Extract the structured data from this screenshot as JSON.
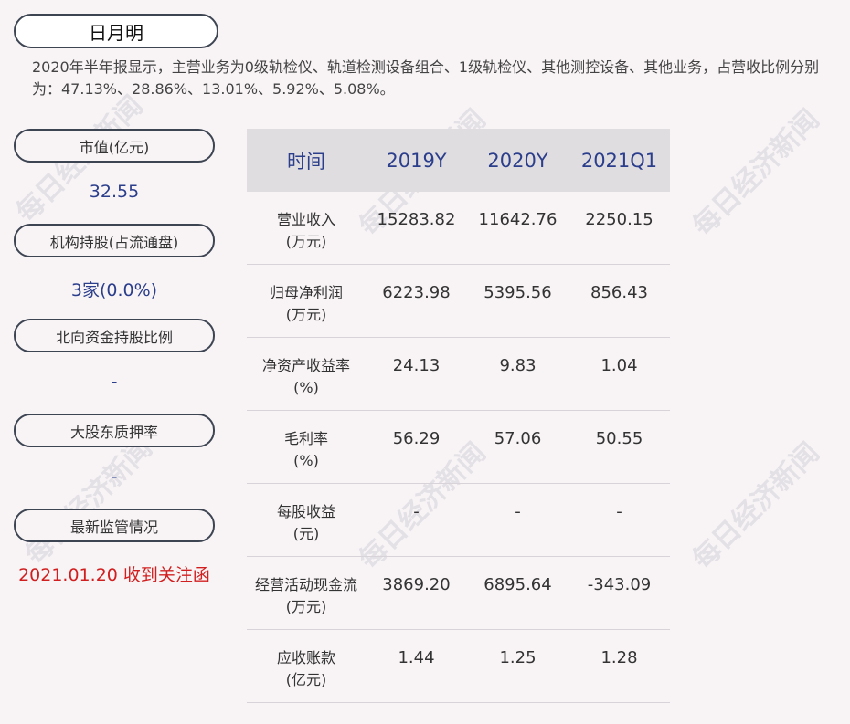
{
  "company": "日月明",
  "summary": "2020年半年报显示，主营业务为0级轨检仪、轨道检测设备组合、1级轨检仪、其他测控设备、其他业务，占营收比例分别为：47.13%、28.86%、13.01%、5.92%、5.08%。",
  "left": {
    "market_cap_label": "市值(亿元)",
    "market_cap_value": "32.55",
    "institution_label": "机构持股(占流通盘)",
    "institution_value": "3家(0.0%)",
    "northbound_label": "北向资金持股比例",
    "northbound_value": "-",
    "pledge_label": "大股东质押率",
    "pledge_value": "-",
    "regulation_label": "最新监管情况",
    "regulation_value": "2021.01.20 收到关注函"
  },
  "table": {
    "header": [
      "时间",
      "2019Y",
      "2020Y",
      "2021Q1"
    ],
    "rows": [
      {
        "label1": "营业收入",
        "label2": "(万元)",
        "values": [
          "15283.82",
          "11642.76",
          "2250.15"
        ]
      },
      {
        "label1": "归母净利润",
        "label2": "(万元)",
        "values": [
          "6223.98",
          "5395.56",
          "856.43"
        ]
      },
      {
        "label1": "净资产收益率",
        "label2": "(%)",
        "values": [
          "24.13",
          "9.83",
          "1.04"
        ]
      },
      {
        "label1": "毛利率",
        "label2": "(%)",
        "values": [
          "56.29",
          "57.06",
          "50.55"
        ]
      },
      {
        "label1": "每股收益",
        "label2": "(元)",
        "values": [
          "-",
          "-",
          "-"
        ]
      },
      {
        "label1": "经营活动现金流",
        "label2": "(万元)",
        "values": [
          "3869.20",
          "6895.64",
          "-343.09"
        ]
      },
      {
        "label1": "应收账款",
        "label2": "(亿元)",
        "values": [
          "1.44",
          "1.25",
          "1.28"
        ]
      }
    ]
  },
  "watermark": "每日经济新闻"
}
